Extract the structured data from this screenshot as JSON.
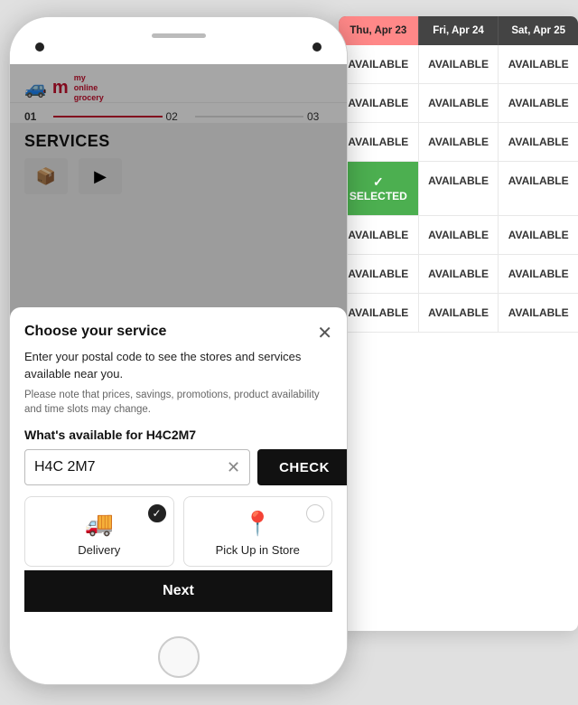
{
  "app": {
    "logo_m": "m",
    "logo_subtitle": "my\nonline\ngrocery"
  },
  "progress": {
    "step1": "01",
    "step2": "02",
    "step3": "03"
  },
  "services_section": {
    "title": "SERVICES"
  },
  "modal": {
    "title": "Choose your service",
    "description": "Enter your postal code to see the stores and services available near you.",
    "note": "Please note that prices, savings, promotions, product availability and time slots may change.",
    "postal_label": "What's available for H4C2M7",
    "input_value": "H4C 2M7",
    "check_btn_label": "CHECK",
    "clear_icon": "✕"
  },
  "service_options": [
    {
      "id": "delivery",
      "label": "Delivery",
      "icon": "🚚",
      "selected": true
    },
    {
      "id": "pickup",
      "label": "Pick Up in Store",
      "icon": "📍",
      "selected": false
    }
  ],
  "next_btn": {
    "label": "Next"
  },
  "calendar": {
    "headers": [
      "Thu, Apr 23",
      "Fri, Apr 24",
      "Sat, Apr 25"
    ],
    "rows": [
      [
        "AVAILABLE",
        "AVAILABLE",
        "AVAILABLE"
      ],
      [
        "AVAILABLE",
        "AVAILABLE",
        "AVAILABLE"
      ],
      [
        "AVAILABLE",
        "AVAILABLE",
        "AVAILABLE"
      ],
      [
        "SELECTED",
        "AVAILABLE",
        "AVAILABLE"
      ],
      [
        "AVAILABLE",
        "AVAILABLE",
        "AVAILABLE"
      ],
      [
        "AVAILABLE",
        "AVAILABLE",
        "AVAILABLE"
      ],
      [
        "AVAILABLE",
        "AVAILABLE",
        "AVAILABLE"
      ]
    ]
  }
}
